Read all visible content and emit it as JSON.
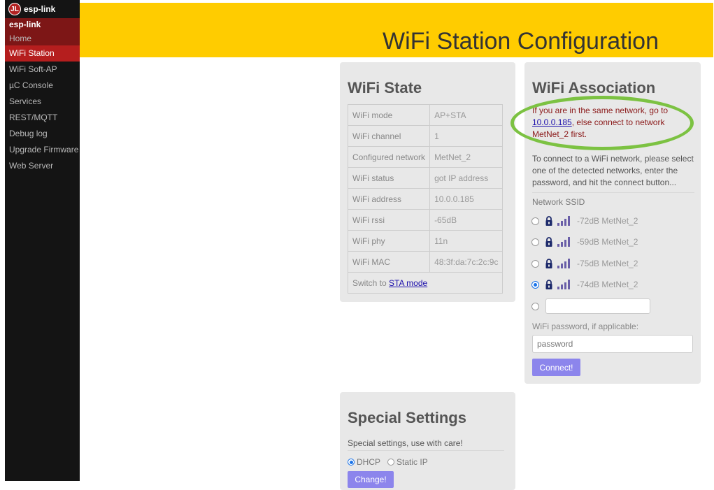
{
  "sidebar": {
    "brand": "esp-link",
    "heading": "esp-link",
    "items": [
      {
        "label": "Home"
      },
      {
        "label": "WiFi Station"
      },
      {
        "label": "WiFi Soft-AP"
      },
      {
        "label": "µC Console"
      },
      {
        "label": "Services"
      },
      {
        "label": "REST/MQTT"
      },
      {
        "label": "Debug log"
      },
      {
        "label": "Upgrade Firmware"
      },
      {
        "label": "Web Server"
      }
    ]
  },
  "header": {
    "title": "WiFi Station Configuration",
    "color": "#ffcc00"
  },
  "wifi_state": {
    "title": "WiFi State",
    "rows": [
      {
        "label": "WiFi mode",
        "value": "AP+STA"
      },
      {
        "label": "WiFi channel",
        "value": "1"
      },
      {
        "label": "Configured network",
        "value": "MetNet_2"
      },
      {
        "label": "WiFi status",
        "value": "got IP address"
      },
      {
        "label": "WiFi address",
        "value": "10.0.0.185"
      },
      {
        "label": "WiFi rssi",
        "value": "-65dB"
      },
      {
        "label": "WiFi phy",
        "value": "11n"
      },
      {
        "label": "WiFi MAC",
        "value": "48:3f:da:7c:2c:9c"
      }
    ],
    "switch_prefix": "Switch to ",
    "switch_link": "STA mode"
  },
  "wifi_association": {
    "title": "WiFi Association",
    "notice_pre": "If you are in the same network, go to ",
    "notice_link": "10.0.0.185",
    "notice_post": ", else connect to network MetNet_2 first.",
    "intro": "To connect to a WiFi network, please select one of the detected networks, enter the password, and hit the connect button...",
    "ssid_label": "Network SSID",
    "networks": [
      {
        "rssi": "-72dB",
        "ssid": "MetNet_2",
        "selected": false
      },
      {
        "rssi": "-59dB",
        "ssid": "MetNet_2",
        "selected": false
      },
      {
        "rssi": "-75dB",
        "ssid": "MetNet_2",
        "selected": false
      },
      {
        "rssi": "-74dB",
        "ssid": "MetNet_2",
        "selected": true
      }
    ],
    "custom_ssid_value": "",
    "password_label": "WiFi password, if applicable:",
    "password_placeholder": "password",
    "connect_label": "Connect!"
  },
  "special_settings": {
    "title": "Special Settings",
    "description": "Special settings, use with care!",
    "options": [
      {
        "label": "DHCP",
        "selected": true
      },
      {
        "label": "Static IP",
        "selected": false
      }
    ],
    "change_label": "Change!"
  }
}
